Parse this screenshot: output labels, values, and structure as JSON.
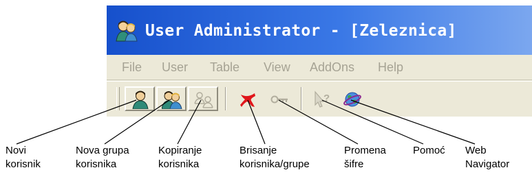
{
  "window": {
    "title": "User Administrator - [Zeleznica]",
    "app_icon": "users-icon"
  },
  "menu": {
    "items": [
      "File",
      "User",
      "Table",
      "View",
      "AddOns",
      "Help"
    ],
    "state": "disabled",
    "color": "#a6a394"
  },
  "toolbar": {
    "buttons": [
      {
        "name": "new-user-button",
        "icon": "user-icon"
      },
      {
        "name": "new-group-button",
        "icon": "group-icon"
      },
      {
        "name": "copy-user-button",
        "icon": "copy-user-icon"
      },
      {
        "name": "delete-button",
        "icon": "red-x-icon"
      },
      {
        "name": "change-password-button",
        "icon": "key-icon"
      },
      {
        "name": "help-button",
        "icon": "help-cursor-icon"
      },
      {
        "name": "web-navigator-button",
        "icon": "globe-icon"
      }
    ]
  },
  "callouts": {
    "novi_korisnik": "Novi\nkorisnik",
    "nova_grupa": "Nova grupa\nkorisnika",
    "kopiranje": "Kopiranje\nkorisnika",
    "brisanje": "Brisanje\nkorisnika/grupe",
    "promena": "Promena\nšifre",
    "pomoc": "Pomoć",
    "web_navigator": "Web\nNavigator"
  },
  "colors": {
    "titlebar": "#1650cc",
    "window_bg": "#ece9d8",
    "delete_icon": "#e0161b"
  }
}
